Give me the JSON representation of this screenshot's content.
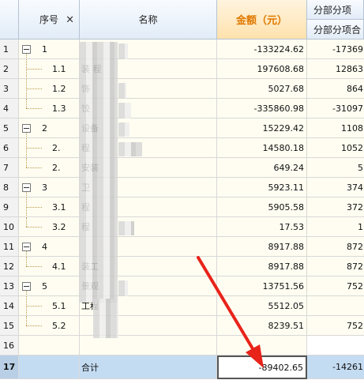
{
  "header": {
    "seq": "序号",
    "close_icon": "×",
    "name": "名称",
    "amount": "金额（元）",
    "fbfx_top": "分部分项",
    "fbfx_bottom": "分部分项合"
  },
  "rows": [
    {
      "num": "1",
      "seq": "1",
      "name": "",
      "amount": "-133224.62",
      "fb": "-17369",
      "level": 0,
      "toggle": true
    },
    {
      "num": "2",
      "seq": "1.1",
      "name": "装  程",
      "amount": "197608.68",
      "fb": "12863",
      "level": 1
    },
    {
      "num": "3",
      "seq": "1.2",
      "name": "饰",
      "amount": "5027.68",
      "fb": "864",
      "level": 1
    },
    {
      "num": "4",
      "seq": "1.3",
      "name": "饺",
      "amount": "-335860.98",
      "fb": "-31097",
      "level": 1
    },
    {
      "num": "5",
      "seq": "2",
      "name": "设备",
      "amount": "15229.42",
      "fb": "1108",
      "level": 0,
      "toggle": true
    },
    {
      "num": "6",
      "seq": "2.",
      "name": "程",
      "amount": "14580.18",
      "fb": "1052",
      "level": 1
    },
    {
      "num": "7",
      "seq": "2.",
      "name": "安装",
      "amount": "649.24",
      "fb": "5",
      "level": 1
    },
    {
      "num": "8",
      "seq": "3",
      "name": "卫",
      "amount": "5923.11",
      "fb": "374",
      "level": 0,
      "toggle": true
    },
    {
      "num": "9",
      "seq": "3.1",
      "name": "程",
      "amount": "5905.58",
      "fb": "372",
      "level": 1
    },
    {
      "num": "10",
      "seq": "3.2",
      "name": "程",
      "amount": "17.53",
      "fb": "1",
      "level": 1
    },
    {
      "num": "11",
      "seq": "4",
      "name": "",
      "amount": "8917.88",
      "fb": "872",
      "level": 0,
      "toggle": true
    },
    {
      "num": "12",
      "seq": "4.1",
      "name": "装工",
      "amount": "8917.88",
      "fb": "872",
      "level": 1
    },
    {
      "num": "13",
      "seq": "5",
      "name": "景观",
      "amount": "13751.56",
      "fb": "752",
      "level": 0,
      "toggle": true
    },
    {
      "num": "14",
      "seq": "5.1",
      "name": "工程",
      "amount": "5512.05",
      "fb": "",
      "level": 1
    },
    {
      "num": "15",
      "seq": "5.2",
      "name": "",
      "amount": "8239.51",
      "fb": "752",
      "level": 1
    },
    {
      "num": "16",
      "seq": "",
      "name": "",
      "amount": "",
      "fb": "",
      "level": -1
    }
  ],
  "total": {
    "num": "17",
    "label": "合计",
    "amount": "-89402.65",
    "fb": "-14261"
  },
  "colors": {
    "row_bg": "#fffdf1",
    "amount_header": "#e07800",
    "total_row": "#c4dcf2",
    "arrow": "#e8231a"
  }
}
